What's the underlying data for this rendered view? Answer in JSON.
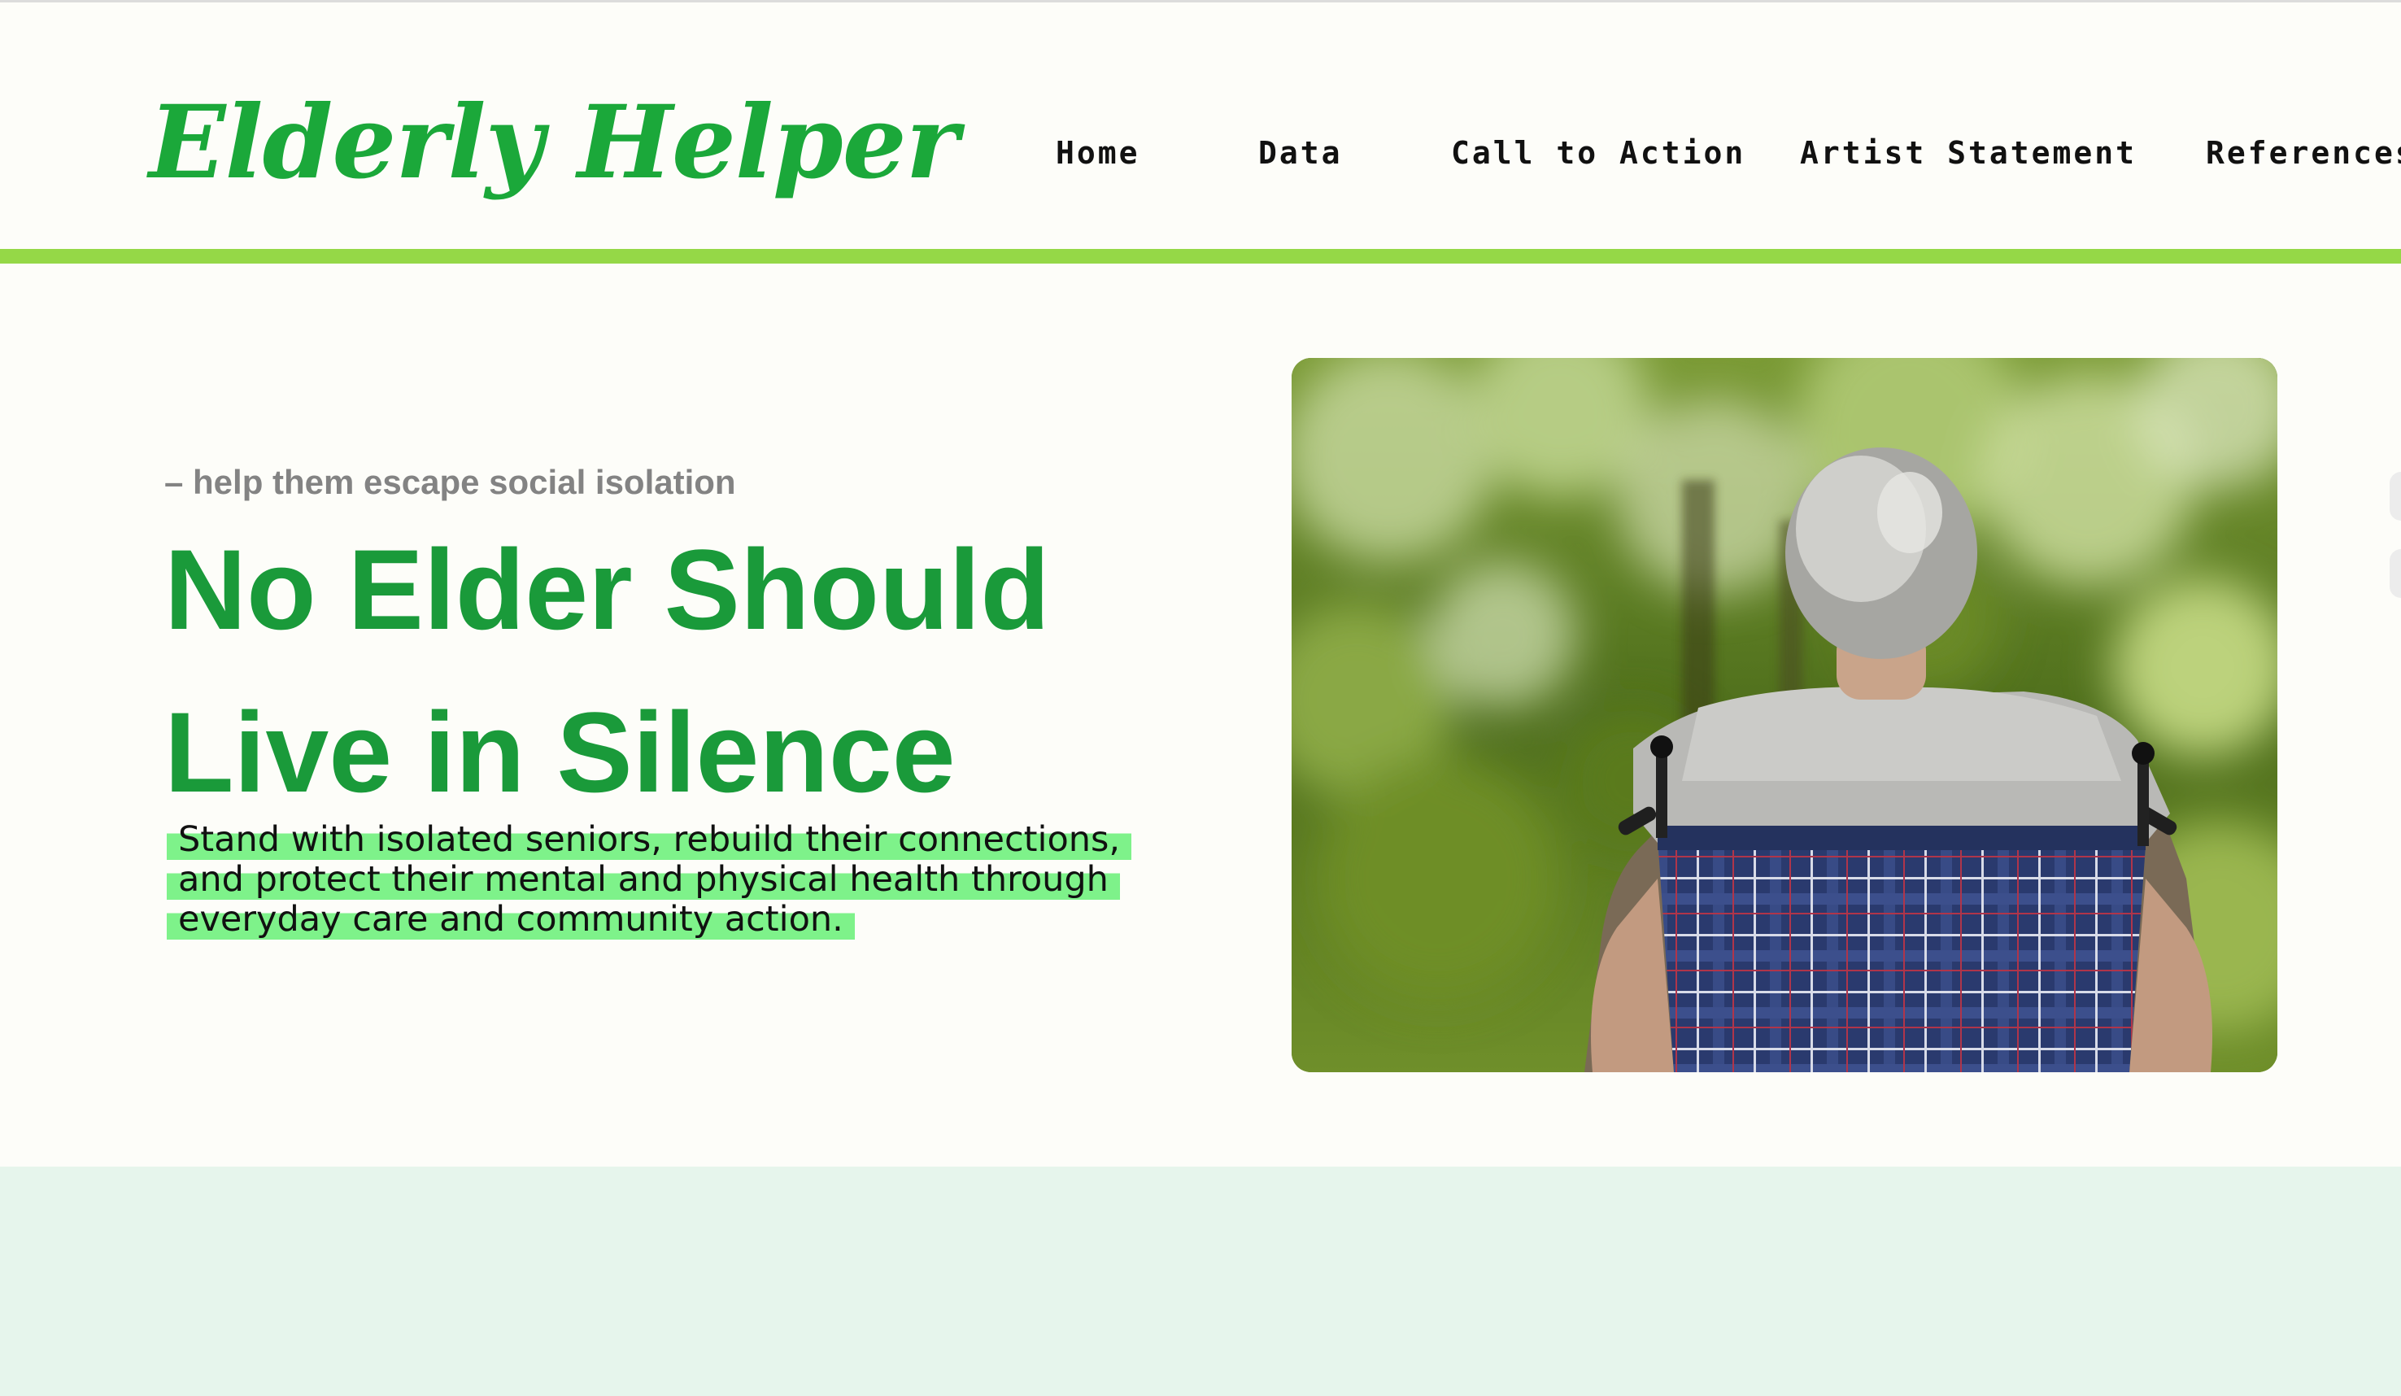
{
  "brand": {
    "name": "Elderly Helper",
    "color": "#1ba83a"
  },
  "nav": {
    "items": [
      {
        "label": "Home"
      },
      {
        "label": "Data"
      },
      {
        "label": "Call to Action"
      },
      {
        "label": "Artist Statement"
      },
      {
        "label": "References"
      }
    ]
  },
  "hero": {
    "eyebrow": "– help them escape social isolation",
    "headline_line1": "No Elder Should",
    "headline_line2": "Live in Silence",
    "subtext_lines": [
      "Stand with isolated seniors, rebuild their connections,",
      "and protect their mental and physical health through",
      "everyday care and community action."
    ],
    "image_icon": "photo-elder-in-wheelchair-icon"
  },
  "colors": {
    "accent_green": "#1a9a3a",
    "header_rule": "#95d847",
    "highlight": "#7ef28a",
    "bottom_band": "#e6f5ec"
  }
}
